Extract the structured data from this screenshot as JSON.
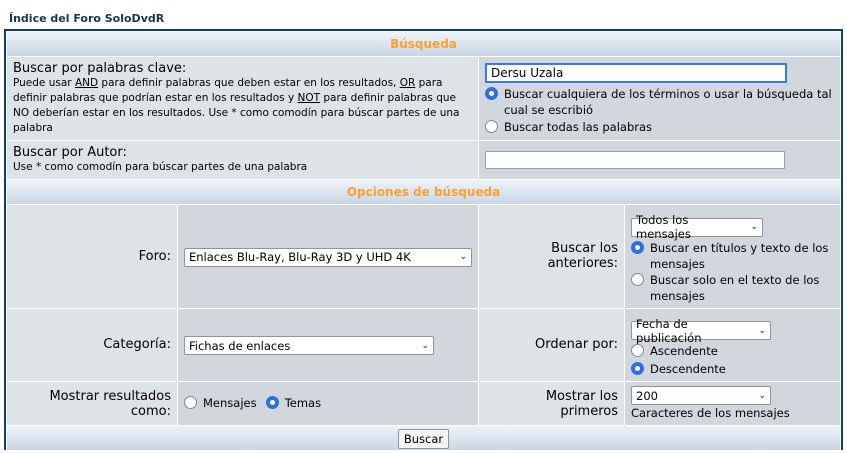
{
  "breadcrumb": {
    "title": "Índice del Foro SoloDvdR"
  },
  "sections": {
    "search_title": "Búsqueda",
    "options_title": "Opciones de búsqueda"
  },
  "keywords": {
    "label": "Buscar por palabras clave:",
    "hint_a": "Puede usar ",
    "hint_and": "AND",
    "hint_b": " para definir palabras que deben estar en los resultados, ",
    "hint_or": "OR",
    "hint_c": " para definir palabras que podrían estar en los resultados y ",
    "hint_not": "NOT",
    "hint_d": " para definir palabras que NO deberían estar en los resultados. Use * como comodín para búscar partes de una palabra",
    "value": "Dersu Uzala",
    "option_any": "Buscar cualquiera de los términos o usar la búsqueda tal cual se escribió",
    "option_all": "Buscar todas las palabras",
    "selected": "any"
  },
  "author": {
    "label": "Buscar por Autor:",
    "hint": "Use * como comodín para búscar partes de una palabra",
    "value": ""
  },
  "forum": {
    "label": "Foro:",
    "selected": "Enlaces Blu-Ray, Blu-Ray 3D y UHD 4K"
  },
  "previous": {
    "label": "Buscar los anteriores:",
    "selected": "Todos los mensajes",
    "option_titles": "Buscar en títulos y texto de los mensajes",
    "option_text": "Buscar solo en el texto de los mensajes",
    "radio_selected": "titles"
  },
  "category": {
    "label": "Categoría:",
    "selected": "Fichas de enlaces"
  },
  "sort": {
    "label": "Ordenar por:",
    "selected": "Fecha de publicación",
    "option_asc": "Ascendente",
    "option_desc": "Descendente",
    "radio_selected": "desc"
  },
  "display": {
    "label": "Mostrar resultados como:",
    "option_posts": "Mensajes",
    "option_topics": "Temas",
    "radio_selected": "topics"
  },
  "first": {
    "label": "Mostrar los primeros",
    "selected": "200",
    "suffix": "Caracteres de los mensajes"
  },
  "submit": {
    "label": "Buscar"
  }
}
